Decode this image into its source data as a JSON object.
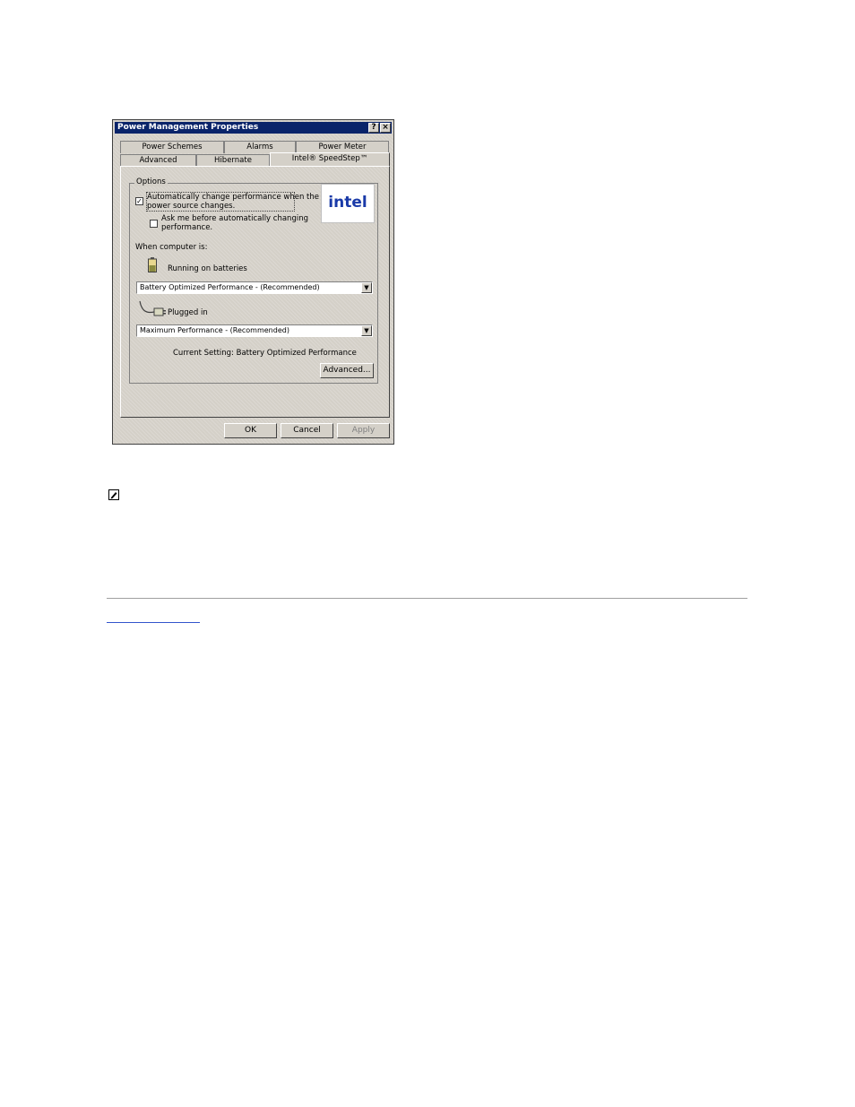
{
  "window": {
    "title": "Power Management Properties",
    "help_btn": "?",
    "close_btn": "×"
  },
  "tabs_row1": [
    "Power Schemes",
    "Alarms",
    "Power Meter"
  ],
  "tabs_row2": [
    "Advanced",
    "Hibernate",
    "Intel® SpeedStep™"
  ],
  "options": {
    "group_label": "Options",
    "auto_change_line1": "Automatically change performance when the",
    "auto_change_line2": "power source changes.",
    "auto_change_checked": true,
    "ask_line1": "Ask me before automatically changing",
    "ask_line2": "performance.",
    "ask_checked": false,
    "logo_text": "intel"
  },
  "when": {
    "label": "When computer is:",
    "battery_label": "Running on batteries",
    "battery_value": "Battery Optimized Performance - (Recommended)",
    "plugged_label": "Plugged in",
    "plugged_value": "Maximum Performance - (Recommended)",
    "current_setting": "Current Setting:  Battery Optimized Performance",
    "advanced_btn": "Advanced..."
  },
  "buttons": {
    "ok": "OK",
    "cancel": "Cancel",
    "apply": "Apply"
  }
}
